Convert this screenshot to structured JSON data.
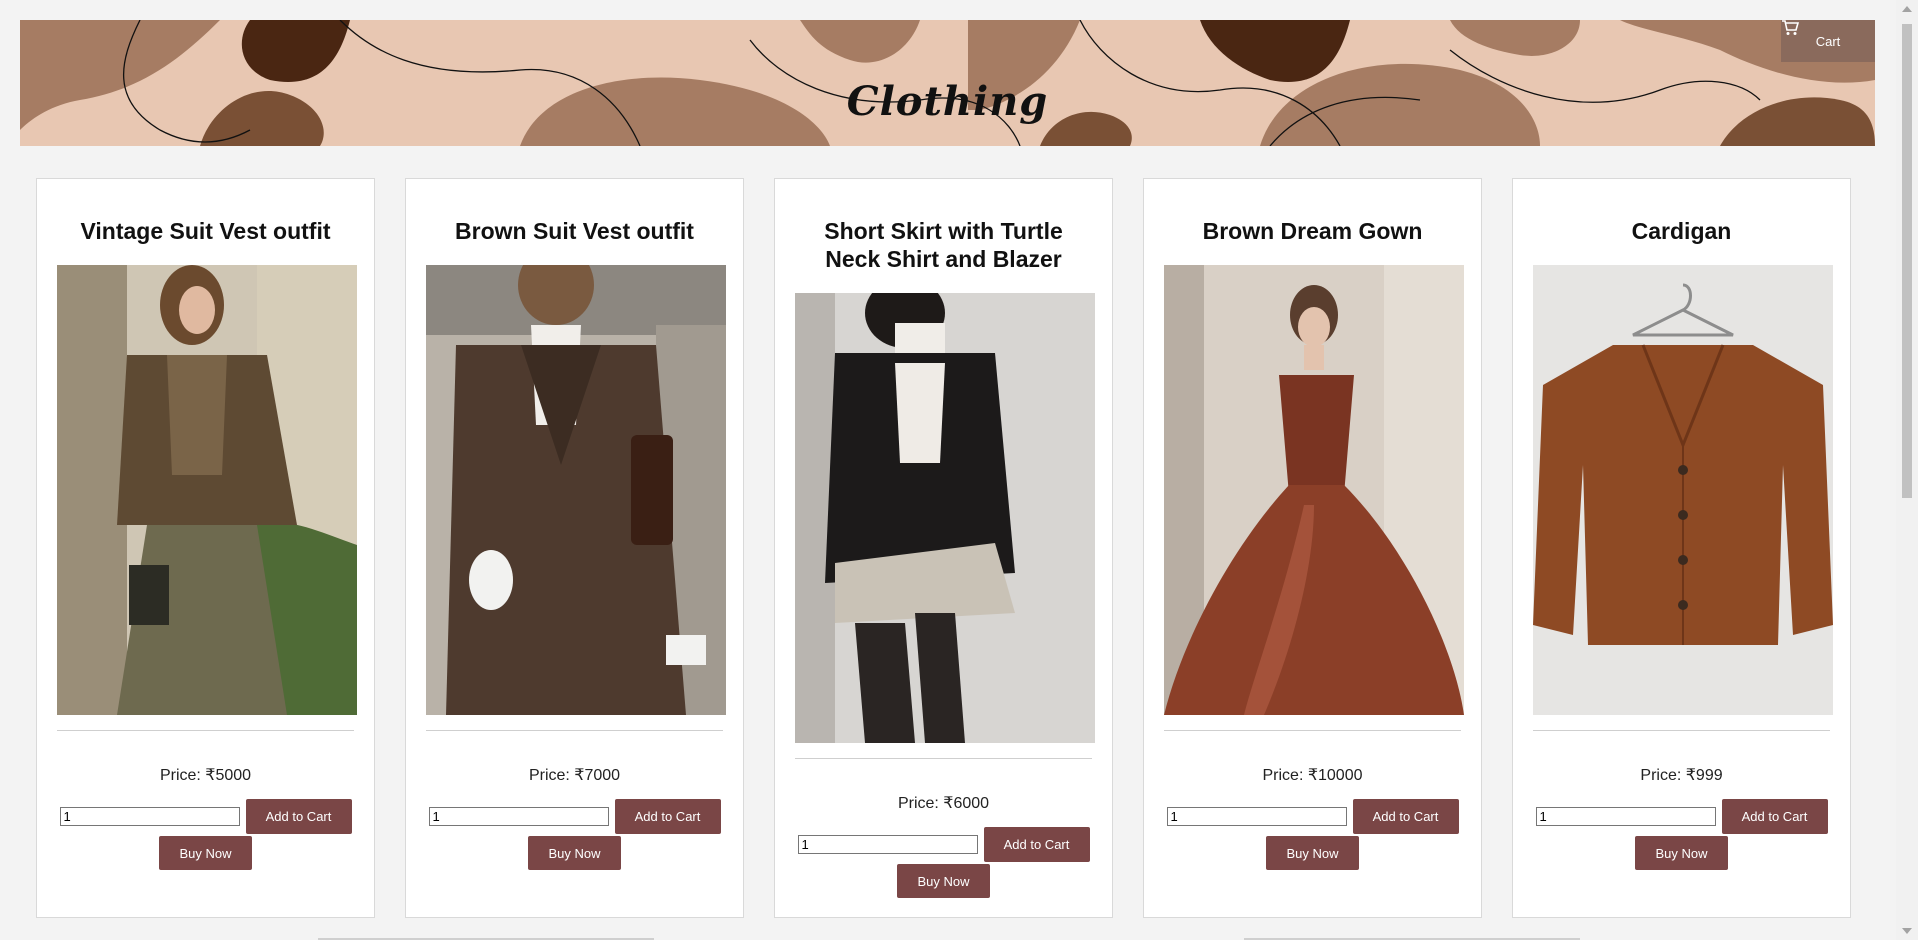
{
  "header": {
    "title": "Clothing",
    "cart_label": "Cart",
    "cart_icon": "cart-icon",
    "banner_colors": [
      "#e8c7b2",
      "#a67c63",
      "#4a2612",
      "#7a5035"
    ]
  },
  "products": [
    {
      "name": "Vintage Suit Vest outfit",
      "price": "Price: ₹5000",
      "quantity": "1",
      "add_label": "Add to Cart",
      "buy_label": "Buy Now",
      "image": "woman-plaid-vest-suit"
    },
    {
      "name": "Brown Suit Vest outfit",
      "price": "Price: ₹7000",
      "quantity": "1",
      "add_label": "Add to Cart",
      "buy_label": "Buy Now",
      "image": "brown-suit-with-bag"
    },
    {
      "name": "Short Skirt with Turtle Neck Shirt and Blazer",
      "price": "Price: ₹6000",
      "quantity": "1",
      "add_label": "Add to Cart",
      "buy_label": "Buy Now",
      "image": "black-blazer-plaid-skirt"
    },
    {
      "name": "Brown Dream Gown",
      "price": "Price: ₹10000",
      "quantity": "1",
      "add_label": "Add to Cart",
      "buy_label": "Buy Now",
      "image": "rust-ball-gown"
    },
    {
      "name": "Cardigan",
      "price": "Price: ₹999",
      "quantity": "1",
      "add_label": "Add to Cart",
      "buy_label": "Buy Now",
      "image": "rust-knit-cardigan-on-hanger"
    }
  ],
  "colors": {
    "button": "#7a4646",
    "cart_button": "#8a6a5c",
    "page_background": "#f3f3f3"
  }
}
